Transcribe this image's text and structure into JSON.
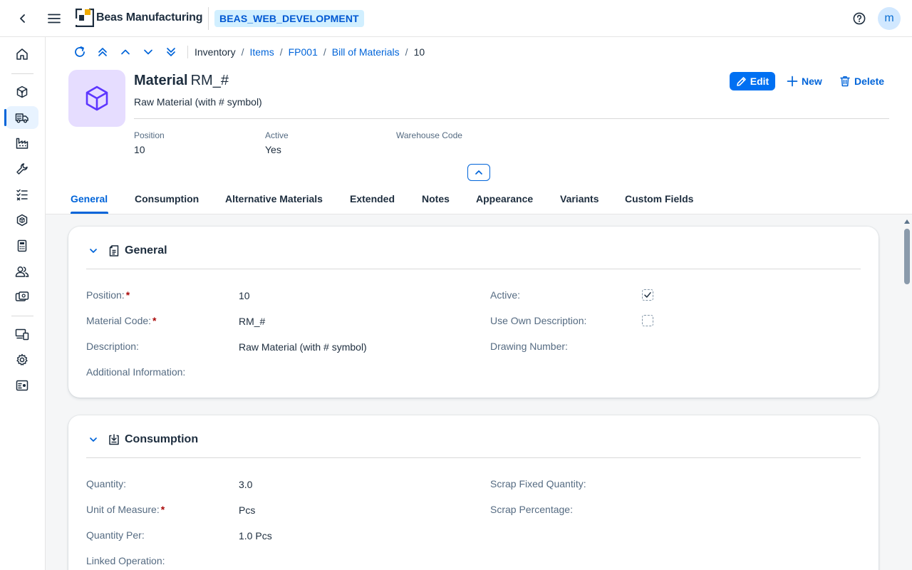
{
  "shell": {
    "brand": "Beas Manufacturing",
    "system": "BEAS_WEB_DEVELOPMENT",
    "avatar_initial": "m"
  },
  "breadcrumb": {
    "items": [
      {
        "label": "Inventory",
        "link": false
      },
      {
        "label": "Items",
        "link": true
      },
      {
        "label": "FP001",
        "link": true
      },
      {
        "label": "Bill of Materials",
        "link": true
      },
      {
        "label": "10",
        "link": false
      }
    ]
  },
  "header": {
    "title_type": "Material",
    "title_id": "RM_#",
    "subtitle": "Raw Material (with # symbol)",
    "actions": {
      "edit": "Edit",
      "new": "New",
      "delete": "Delete"
    },
    "fields": [
      {
        "label": "Position",
        "value": "10"
      },
      {
        "label": "Active",
        "value": "Yes"
      },
      {
        "label": "Warehouse Code",
        "value": ""
      }
    ]
  },
  "tabs": [
    "General",
    "Consumption",
    "Alternative Materials",
    "Extended",
    "Notes",
    "Appearance",
    "Variants",
    "Custom Fields"
  ],
  "general_section": {
    "title": "General",
    "position_label": "Position:",
    "position_value": "10",
    "material_code_label": "Material Code:",
    "material_code_value": "RM_#",
    "description_label": "Description:",
    "description_value": "Raw Material (with # symbol)",
    "additional_info_label": "Additional Information:",
    "active_label": "Active:",
    "active_checked": true,
    "use_own_desc_label": "Use Own Description:",
    "use_own_desc_checked": false,
    "drawing_number_label": "Drawing Number:"
  },
  "consumption_section": {
    "title": "Consumption",
    "quantity_label": "Quantity:",
    "quantity_value": "3.0",
    "uom_label": "Unit of Measure:",
    "uom_value": "Pcs",
    "quantity_per_label": "Quantity Per:",
    "quantity_per_value": "1.0 Pcs",
    "linked_operation_label": "Linked Operation:",
    "scrap_fixed_label": "Scrap Fixed Quantity:",
    "scrap_pct_label": "Scrap Percentage:"
  },
  "colors": {
    "accent": "#0064d9",
    "button": "#0070f2",
    "badge_bg": "#d1efff",
    "object_avatar_bg": "#e6ddff",
    "object_icon": "#5d36ff",
    "required": "#aa0808"
  }
}
